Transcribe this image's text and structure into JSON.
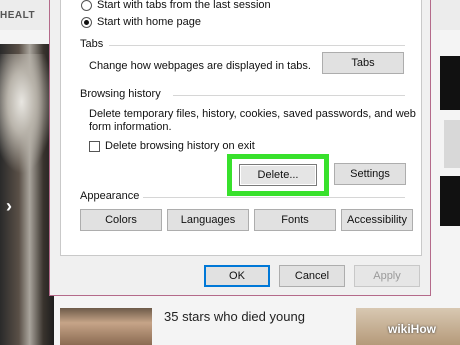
{
  "background": {
    "header_label": "HEALT",
    "chevron": "›",
    "article_title": "35 stars who died young",
    "watermark": "wikiHow"
  },
  "dialog": {
    "startup_options": [
      {
        "label": "Start with tabs from the last session",
        "checked": false
      },
      {
        "label": "Start with home page",
        "checked": true
      }
    ],
    "tabs_section": {
      "title": "Tabs",
      "description": "Change how webpages are displayed in tabs.",
      "button": "Tabs"
    },
    "history_section": {
      "title": "Browsing history",
      "description_line1": "Delete temporary files, history, cookies, saved passwords, and web",
      "description_line2": "form information.",
      "checkbox_label": "Delete browsing history on exit",
      "checkbox_checked": false,
      "delete_button": "Delete...",
      "settings_button": "Settings"
    },
    "appearance_section": {
      "title": "Appearance",
      "buttons": [
        "Colors",
        "Languages",
        "Fonts",
        "Accessibility"
      ]
    },
    "footer": {
      "ok": "OK",
      "cancel": "Cancel",
      "apply": "Apply"
    }
  },
  "colors": {
    "highlight": "#38e12c",
    "primary_border": "#0078d7",
    "dialog_border": "#b46a8a"
  }
}
